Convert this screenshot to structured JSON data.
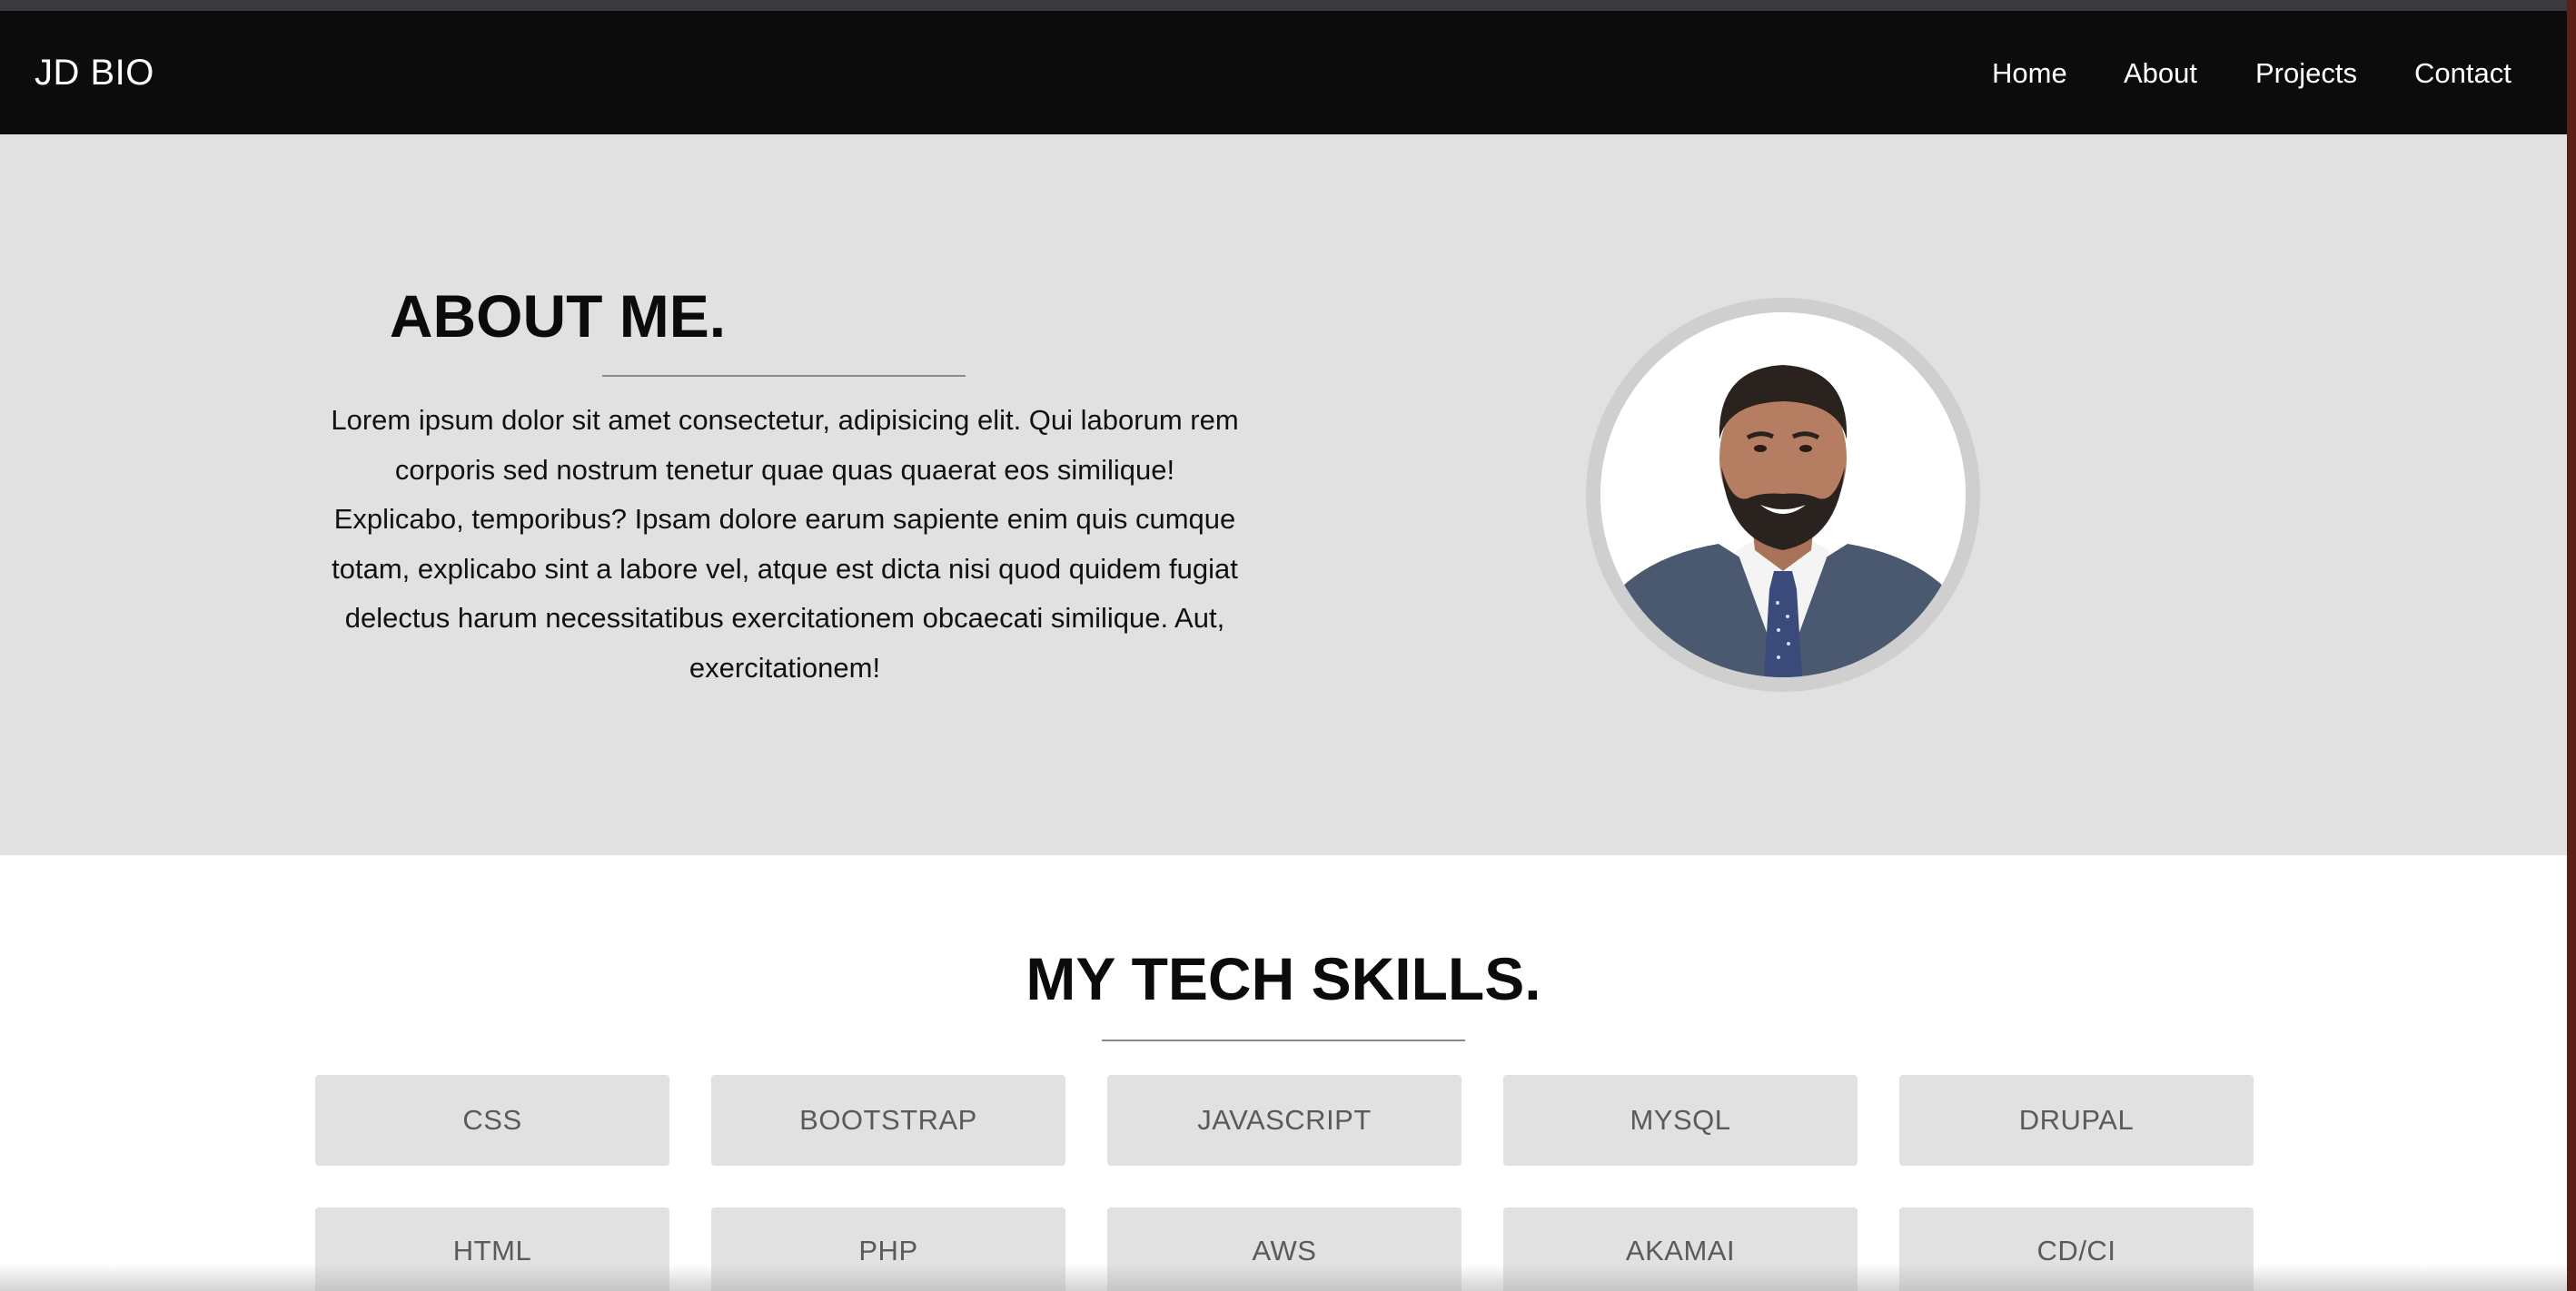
{
  "navbar": {
    "brand": "JD BIO",
    "links": [
      {
        "label": "Home"
      },
      {
        "label": "About"
      },
      {
        "label": "Projects"
      },
      {
        "label": "Contact"
      }
    ]
  },
  "about": {
    "title": "ABOUT ME.",
    "text": "Lorem ipsum dolor sit amet consectetur, adipisicing elit. Qui laborum rem corporis sed nostrum tenetur quae quas quaerat eos similique! Explicabo, temporibus? Ipsam dolore earum sapiente enim quis cumque totam, explicabo sint a labore vel, atque est dicta nisi quod quidem fugiat delectus harum necessitatibus exercitationem obcaecati similique. Aut, exercitationem!",
    "photo_icon": "profile-photo"
  },
  "skills": {
    "title": "MY TECH SKILLS.",
    "items": [
      {
        "label": "CSS"
      },
      {
        "label": "BOOTSTRAP"
      },
      {
        "label": "JAVASCRIPT"
      },
      {
        "label": "MYSQL"
      },
      {
        "label": "DRUPAL"
      },
      {
        "label": "HTML"
      },
      {
        "label": "PHP"
      },
      {
        "label": "AWS"
      },
      {
        "label": "AKAMAI"
      },
      {
        "label": "CD/CI"
      }
    ]
  },
  "colors": {
    "navbar_bg": "#0c0c0c",
    "about_bg": "#e1e1e1",
    "skill_bg": "#e1e1e1",
    "text_dark": "#0b0b0b"
  }
}
